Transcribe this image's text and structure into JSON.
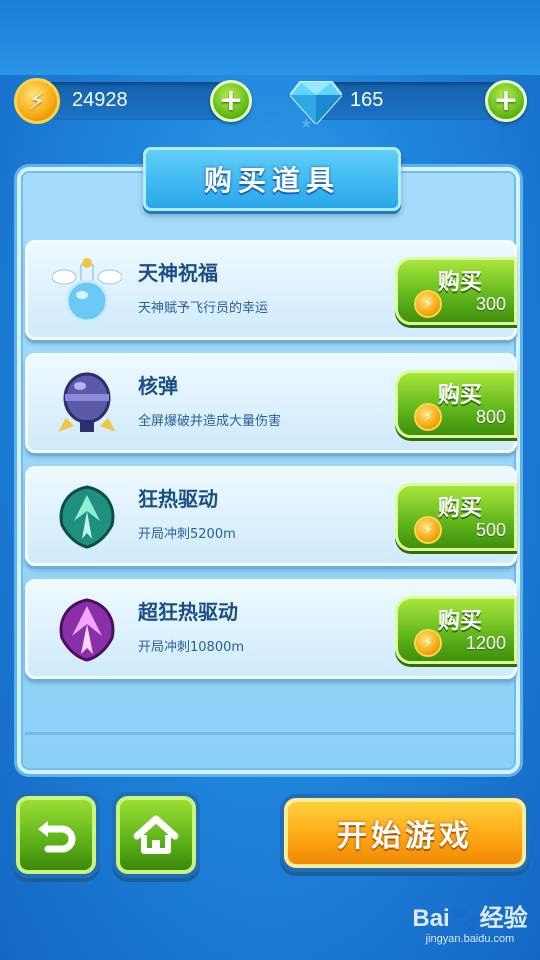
{
  "resources": {
    "coins": "24928",
    "coin_glyph": "⚡",
    "gems": "165",
    "plus_glyph": "+"
  },
  "shop": {
    "title": "购买道具",
    "buy_label": "购买",
    "coin_glyph": "⚡",
    "items": [
      {
        "name": "天神祝福",
        "desc": "天神赋予飞行员的幸运",
        "price": "300",
        "icon": "winged-potion-icon"
      },
      {
        "name": "核弹",
        "desc": "全屏爆破并造成大量伤害",
        "price": "800",
        "icon": "nuke-bomb-icon"
      },
      {
        "name": "狂热驱动",
        "desc": "开局冲刺5200m",
        "price": "500",
        "icon": "teal-wing-badge-icon"
      },
      {
        "name": "超狂热驱动",
        "desc": "开局冲刺10800m",
        "price": "1200",
        "icon": "purple-wing-badge-icon"
      }
    ]
  },
  "bottom": {
    "back_glyph": "↺",
    "home_glyph": "⌂",
    "start_label": "开始游戏"
  },
  "watermark": {
    "logo": "Bai🐾经验",
    "url": "jingyan.baidu.com"
  },
  "colors": {
    "background": "#1f86dd",
    "panel": "#a6dcfb",
    "buy_green": "#5fb51b",
    "start_orange": "#ffa815",
    "coin_gold": "#f5a90f"
  }
}
